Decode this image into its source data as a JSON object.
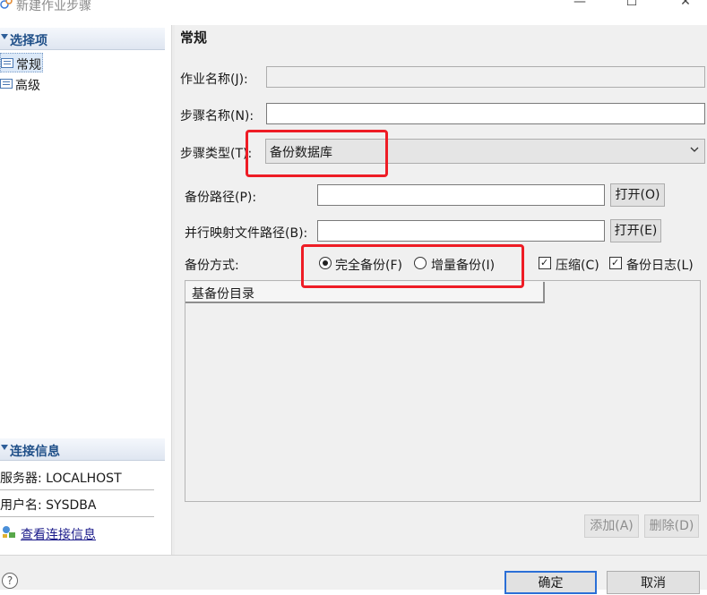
{
  "window": {
    "title": "新建作业步骤",
    "minimize_glyph": "—",
    "maximize_glyph": "☐",
    "close_glyph": "✕"
  },
  "sidebar": {
    "section_title": "选择项",
    "items": [
      {
        "label": "常规",
        "icon": "page-list-icon",
        "selected": true
      },
      {
        "label": "高级",
        "icon": "page-list-icon",
        "selected": false
      }
    ],
    "connection": {
      "title": "连接信息",
      "server": "服务器: LOCALHOST",
      "user": "用户名: SYSDBA",
      "link": "查看连接信息"
    }
  },
  "main": {
    "title": "常规",
    "fields": {
      "job_name": {
        "label": "作业名称(J):",
        "value": ""
      },
      "step_name": {
        "label": "步骤名称(N):",
        "value": ""
      },
      "step_type": {
        "label": "步骤类型(T):",
        "value": "备份数据库"
      },
      "backup_path": {
        "label": "备份路径(P):",
        "value": "",
        "button": "打开(O)"
      },
      "mirror_path": {
        "label": "并行映射文件路径(B):",
        "value": "",
        "button": "打开(E)"
      }
    },
    "backup_mode": {
      "label": "备份方式:",
      "options": [
        {
          "label": "完全备份(F)",
          "checked": true
        },
        {
          "label": "增量备份(I)",
          "checked": false
        }
      ],
      "compress": {
        "label": "压缩(C)",
        "checked": true
      },
      "backup_log": {
        "label": "备份日志(L)",
        "checked": true
      }
    },
    "base_dir_list": {
      "column_header": "基备份目录",
      "add_button": "添加(A)",
      "delete_button": "删除(D)"
    }
  },
  "footer": {
    "help_glyph": "?",
    "ok_button": "确定",
    "cancel_button": "取消"
  },
  "colors": {
    "highlight": "#ee1c25",
    "accent": "#2b6fd6",
    "section_header_text": "#1f4f88"
  }
}
